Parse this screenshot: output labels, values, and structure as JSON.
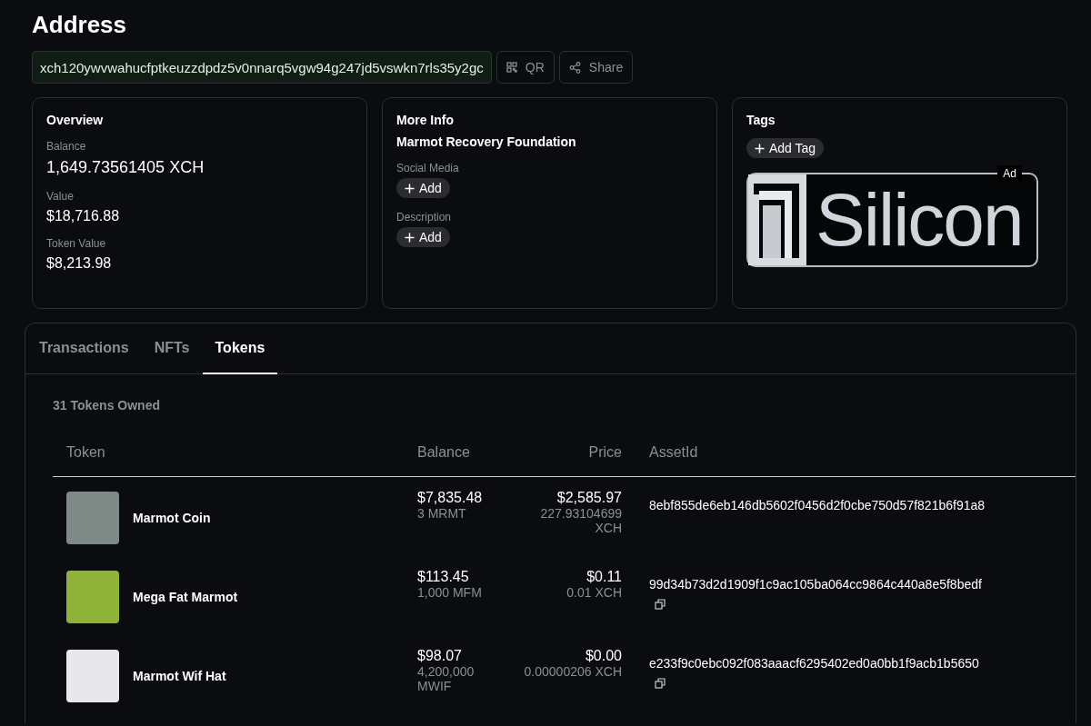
{
  "title": "Address",
  "address": {
    "value": "xch120ywvwahucfptkeuzzdpdz5v0nnarq5vgw94g247jd5vswkn7rls35y2gc",
    "buttons": [
      {
        "kind": "qr",
        "label": "QR"
      },
      {
        "kind": "share",
        "label": "Share"
      }
    ]
  },
  "overview": {
    "title": "Overview",
    "fields": [
      {
        "label": "Balance",
        "value": "1,649.73561405 XCH",
        "kind": "large"
      },
      {
        "label": "Value",
        "value": "$18,716.88",
        "kind": "normal"
      },
      {
        "label": "Token Value",
        "value": "$8,213.98",
        "kind": "normal"
      }
    ]
  },
  "more_info": {
    "title": "More Info",
    "name": "Marmot Recovery Foundation",
    "sections": [
      {
        "label": "Social Media",
        "button": "Add"
      },
      {
        "label": "Description",
        "button": "Add"
      }
    ]
  },
  "tags": {
    "title": "Tags",
    "button": "Add Tag",
    "ad": {
      "badge": "Ad",
      "brand": "Silicon"
    }
  },
  "tabs": [
    {
      "label": "Transactions",
      "selected": false
    },
    {
      "label": "NFTs",
      "selected": false
    },
    {
      "label": "Tokens",
      "selected": true
    }
  ],
  "tokens": {
    "count": "31 Tokens Owned",
    "columns": [
      "Token",
      "Balance",
      "Price",
      "AssetId"
    ],
    "rows": [
      {
        "name": "Marmot Coin",
        "balance": "$7,835.48",
        "amount": "3 MRMT",
        "price": "$2,585.97",
        "price_xch": "227.93104699 XCH",
        "asset_id": "8ebf855de6eb146db5602f0456d2f0cbe750d57f821b6f91a8",
        "copyable": false
      },
      {
        "name": "Mega Fat Marmot",
        "balance": "$113.45",
        "amount": "1,000 MFM",
        "price": "$0.11",
        "price_xch": "0.01 XCH",
        "asset_id": "99d34b73d2d1909f1c9ac105ba064cc9864c440a8e5f8bedf",
        "copyable": true
      },
      {
        "name": "Marmot Wif Hat",
        "balance": "$98.07",
        "amount": "4,200,000 MWIF",
        "price": "$0.00",
        "price_xch": "0.00000206 XCH",
        "asset_id": "e233f9c0ebc092f083aaacf6295402ed0a0bb1f9acb1b5650",
        "copyable": true
      }
    ]
  }
}
